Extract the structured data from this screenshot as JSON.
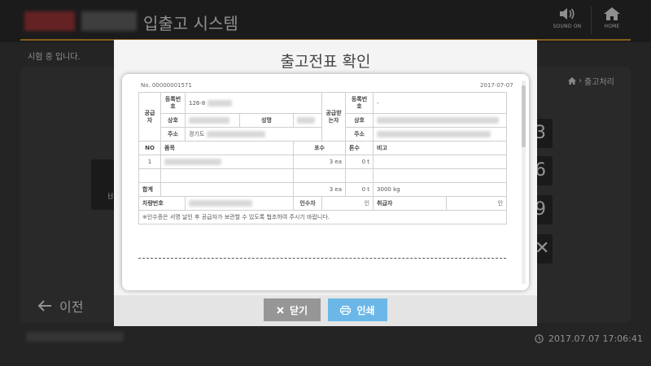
{
  "app": {
    "title": "입출고 시스템",
    "sound_label": "SOUND ON",
    "home_label": "HOME",
    "testing_text": "시험 중 입니다.",
    "breadcrumb": "출고처리",
    "prev_label": "이전",
    "clock": "2017.07.07 17:06:41",
    "side_keys": [
      "3",
      "6",
      "9",
      "✕"
    ],
    "left_box_label": "비"
  },
  "modal": {
    "title": "출고전표 확인",
    "close_label": "닫기",
    "print_label": "인쇄"
  },
  "slip": {
    "no": "No. 00000001571",
    "date": "2017-07-07",
    "supplier_label": "공급자",
    "receiver_label": "공급받는자",
    "reg_no_label": "등록번호",
    "supplier_reg_no": "126-8",
    "name_label": "성명",
    "company_label": "상호",
    "address_label": "주소",
    "supplier_address": "경기도",
    "receiver_reg_no": "-",
    "columns": [
      "NO",
      "품목",
      "포수",
      "톤수",
      "비고"
    ],
    "rows": [
      {
        "no": "1",
        "qty": "3 ea",
        "ton": "0 t",
        "note": ""
      }
    ],
    "total_label": "합계",
    "total_qty": "3 ea",
    "total_ton": "0 t",
    "total_note": "3000 kg",
    "vehicle_label": "차량번호",
    "receiver_person_label": "인수자",
    "handler_label": "취급자",
    "seal": "인",
    "footnote": "※인수증은 서명 날인 후 공급자가 보관할 수 있도록 협조하여 주시기 바랍니다."
  },
  "colors": {
    "accent": "#d69a2b",
    "print_button": "#6bb7e8",
    "close_button": "#969696"
  }
}
